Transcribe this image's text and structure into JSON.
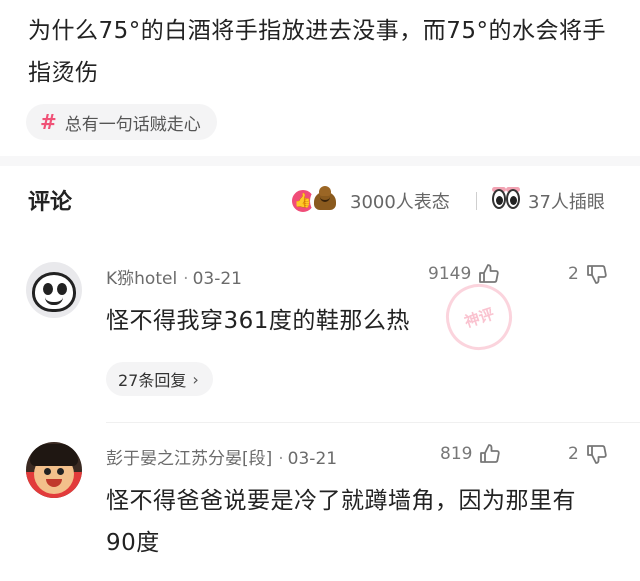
{
  "post": {
    "title": "为什么75°的白酒将手指放进去没事，而75°的水会将手指烫伤",
    "topic": {
      "icon": "hash-icon",
      "label": "总有一句话贼走心"
    }
  },
  "comments_header": {
    "title": "评论",
    "reactions": {
      "icons": [
        "like-icon",
        "poop-icon"
      ],
      "count_label": "3000人表态"
    },
    "interjections": {
      "icon": "eyes-icon",
      "count_label": "37人插眼"
    }
  },
  "comments": [
    {
      "username": "K猕hotel",
      "date": "03-21",
      "likes": "9149",
      "dislikes": "2",
      "text": "怪不得我穿361度的鞋那么热",
      "replies_label": "27条回复",
      "badge": "神评"
    },
    {
      "username": "彭于晏之江苏分晏[段]",
      "date": "03-21",
      "likes": "819",
      "dislikes": "2",
      "text": "怪不得爸爸说要是冷了就蹲墙角，因为那里有90度"
    }
  ],
  "colors": {
    "accent": "#f05277",
    "chip_bg": "#f4f4f5",
    "text": "#222222",
    "meta": "#6b6b6b"
  }
}
